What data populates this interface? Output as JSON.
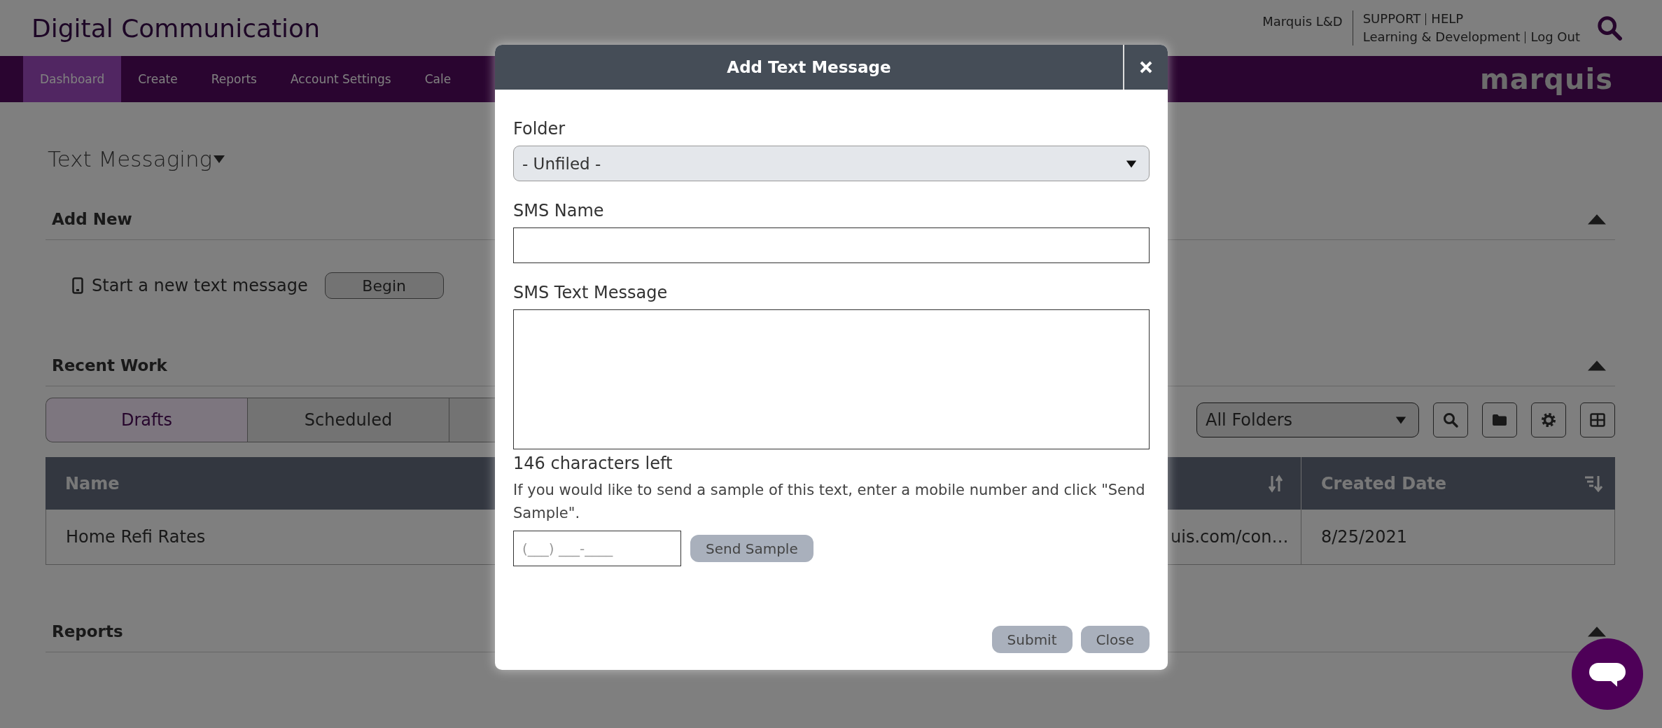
{
  "header": {
    "title": "Digital Communication",
    "user": "Marquis L&D",
    "links_top": [
      "SUPPORT",
      "HELP"
    ],
    "links_bottom": [
      "Learning & Development",
      "Log Out"
    ]
  },
  "nav": {
    "items": [
      {
        "label": "Dashboard",
        "selected": true
      },
      {
        "label": "Create",
        "selected": false
      },
      {
        "label": "Reports",
        "selected": false
      },
      {
        "label": "Account Settings",
        "selected": false
      },
      {
        "label": "Cale",
        "selected": false
      }
    ],
    "logo": "marquis"
  },
  "page_title": "Text Messaging",
  "add_new": {
    "heading": "Add New",
    "expanded": true,
    "prompt": "Start a new text message",
    "button": "Begin"
  },
  "recent_work": {
    "heading": "Recent Work",
    "expanded": true,
    "tabs": [
      {
        "label": "Drafts",
        "selected": true
      },
      {
        "label": "Scheduled",
        "selected": false
      },
      {
        "selected": false
      }
    ],
    "folder_filter": "All Folders",
    "table": {
      "columns": [
        {
          "label": "Name",
          "kind": "plain"
        },
        {
          "kind": "sortable"
        },
        {
          "label": "Created Date",
          "kind": "sorted"
        }
      ],
      "rows": [
        {
          "cells": [
            "Home Refi Rates",
            "uis.com/con…",
            "8/25/2021"
          ]
        }
      ]
    }
  },
  "reports": {
    "heading": "Reports",
    "expanded": true
  },
  "modal": {
    "title": "Add Text Message",
    "folder_label": "Folder",
    "folder_value": "- Unfiled -",
    "name_label": "SMS Name",
    "message_label": "SMS Text Message",
    "counter": "146 characters left",
    "sample_hint": "If you would like to send a sample of this text, enter a mobile number and click \"Send Sample\".",
    "phone_placeholder": "(___) ___-____",
    "send_button": "Send Sample",
    "buttons": [
      "Submit",
      "Close"
    ]
  }
}
